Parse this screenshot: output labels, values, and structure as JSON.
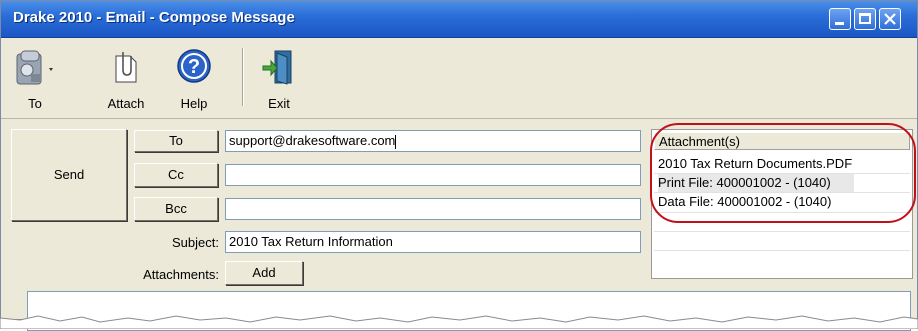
{
  "window": {
    "title": "Drake 2010 - Email - Compose Message",
    "controls": [
      "minimize",
      "maximize",
      "close"
    ]
  },
  "toolbar": {
    "items": [
      {
        "label": "To",
        "icon": "address-book-icon"
      },
      {
        "label": "Attach",
        "icon": "paperclip-icon"
      },
      {
        "label": "Help",
        "icon": "help-icon"
      },
      {
        "label": "Exit",
        "icon": "exit-door-icon"
      }
    ]
  },
  "compose": {
    "send_label": "Send",
    "to_label": "To",
    "cc_label": "Cc",
    "bcc_label": "Bcc",
    "subject_label": "Subject:",
    "attachments_label": "Attachments:",
    "add_label": "Add",
    "to_value": "support@drakesoftware.com",
    "cc_value": "",
    "bcc_value": "",
    "subject_value": "2010 Tax Return Information"
  },
  "attachments": {
    "header": "Attachment(s)",
    "items": [
      "2010 Tax Return Documents.PDF",
      "Print File: 400001002 - (1040)",
      "Data File: 400001002 - (1040)"
    ]
  },
  "colors": {
    "titlebar": "#2a6ed8",
    "window_bg": "#ece9d8",
    "highlight_oval": "#c0101a"
  }
}
